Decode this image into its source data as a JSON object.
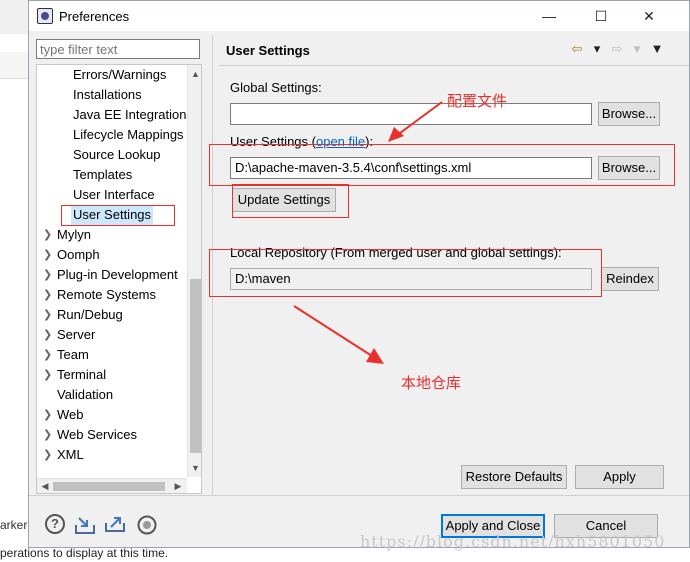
{
  "background": {
    "markers_tab_fragment": "arker",
    "status_fragment": "perations to display at this time."
  },
  "dialog": {
    "title": "Preferences",
    "minimize": "—",
    "maximize": "☐",
    "close": "✕"
  },
  "filter": {
    "placeholder": "type filter text"
  },
  "tree": {
    "children": [
      "Errors/Warnings",
      "Installations",
      "Java EE Integration",
      "Lifecycle Mappings",
      "Source Lookup",
      "Templates",
      "User Interface",
      "User Settings"
    ],
    "top": [
      "Mylyn",
      "Oomph",
      "Plug-in Development",
      "Remote Systems",
      "Run/Debug",
      "Server",
      "Team",
      "Terminal",
      "Validation",
      "Web",
      "Web Services",
      "XML"
    ],
    "selected": "User Settings"
  },
  "page": {
    "title": "User Settings",
    "global_label": "Global Settings:",
    "global_value": "",
    "browse1": "Browse...",
    "user_label_pre": "User Settings (",
    "user_label_link": "open file",
    "user_label_post": "):",
    "user_value": "D:\\apache-maven-3.5.4\\conf\\settings.xml",
    "browse2": "Browse...",
    "update": "Update Settings",
    "local_label": "Local Repository (From merged user and global settings):",
    "local_value": "D:\\maven",
    "reindex": "Reindex",
    "restore": "Restore Defaults",
    "apply": "Apply"
  },
  "footer": {
    "help_icon_glyph": "?",
    "apply_close": "Apply and Close",
    "cancel": "Cancel"
  },
  "annotations": {
    "note_config": "配置文件",
    "note_local": "本地仓库",
    "watermark": "https://blog.csdn.net/hxh5801050",
    "color": "#e8312f"
  }
}
